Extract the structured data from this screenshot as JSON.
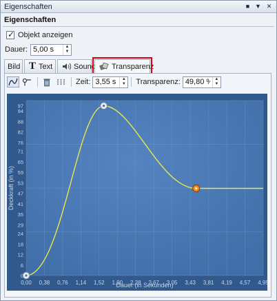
{
  "window": {
    "title": "Eigenschaften"
  },
  "section_title": "Eigenschaften",
  "show_object": {
    "label": "Objekt anzeigen",
    "checked": true
  },
  "duration": {
    "label": "Dauer:",
    "value": "5,00 s"
  },
  "tabs": [
    {
      "label": "Bild",
      "icon": "none"
    },
    {
      "label": "Text",
      "icon": "text-T-icon"
    },
    {
      "label": "Sound",
      "icon": "speaker-icon"
    },
    {
      "label": "Transparenz",
      "icon": "transparency-icon",
      "active": true
    }
  ],
  "toolbar": {
    "zeit_label": "Zeit:",
    "zeit_value": "3,55 s",
    "transparenz_label": "Transparenz:",
    "transparenz_value": "49,80 %"
  },
  "chart_data": {
    "type": "line",
    "xlabel": "Dauer (in Sekunden)",
    "ylabel": "Deckkraft (in %)",
    "x_ticks": [
      "0,00",
      "0,38",
      "0,76",
      "1,14",
      "1,52",
      "1,90",
      "2,28",
      "2,67",
      "3,05",
      "3,43",
      "3,81",
      "4,19",
      "4,57",
      "4,95"
    ],
    "y_ticks": [
      "0",
      "6",
      "12",
      "18",
      "24",
      "29",
      "35",
      "41",
      "47",
      "53",
      "59",
      "65",
      "71",
      "76",
      "82",
      "88",
      "94",
      "97"
    ],
    "xlim": [
      0,
      4.95
    ],
    "ylim": [
      0,
      100
    ],
    "keyframes": [
      {
        "x": 0.0,
        "y": 0
      },
      {
        "x": 1.62,
        "y": 97
      },
      {
        "x": 3.55,
        "y": 49.8
      }
    ],
    "end_x": 4.95,
    "grid": true,
    "colors": {
      "background": "#3f6ea9",
      "curve": "#e8e84a",
      "grid": "#7fa1cc",
      "label": "#c6d6ec"
    }
  }
}
